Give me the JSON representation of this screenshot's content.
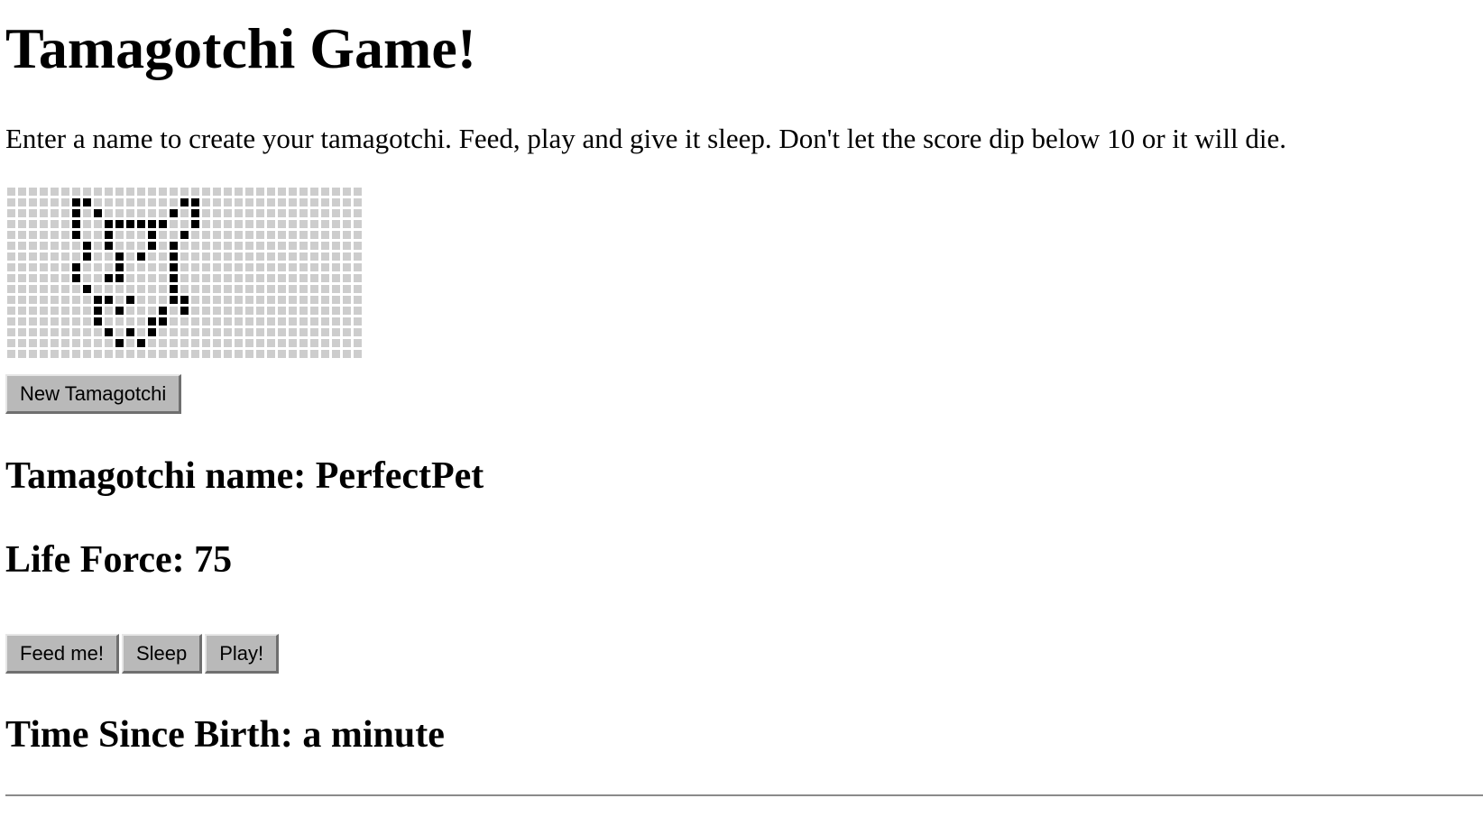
{
  "title": "Tamagotchi Game!",
  "intro": "Enter a name to create your tamagotchi. Feed, play and give it sleep. Don't let the score dip below 10 or it will die.",
  "canvas": {
    "cols": 33,
    "rows": 16,
    "on_pixels": [
      [
        1,
        6
      ],
      [
        1,
        7
      ],
      [
        1,
        16
      ],
      [
        1,
        17
      ],
      [
        2,
        6
      ],
      [
        2,
        8
      ],
      [
        2,
        15
      ],
      [
        2,
        17
      ],
      [
        3,
        6
      ],
      [
        3,
        9
      ],
      [
        3,
        10
      ],
      [
        3,
        11
      ],
      [
        3,
        12
      ],
      [
        3,
        13
      ],
      [
        3,
        14
      ],
      [
        3,
        17
      ],
      [
        4,
        6
      ],
      [
        4,
        9
      ],
      [
        4,
        13
      ],
      [
        4,
        16
      ],
      [
        5,
        7
      ],
      [
        5,
        9
      ],
      [
        5,
        13
      ],
      [
        5,
        15
      ],
      [
        6,
        7
      ],
      [
        6,
        10
      ],
      [
        6,
        12
      ],
      [
        6,
        15
      ],
      [
        7,
        6
      ],
      [
        7,
        10
      ],
      [
        7,
        15
      ],
      [
        8,
        6
      ],
      [
        8,
        9
      ],
      [
        8,
        10
      ],
      [
        8,
        15
      ],
      [
        9,
        7
      ],
      [
        9,
        15
      ],
      [
        10,
        8
      ],
      [
        10,
        9
      ],
      [
        10,
        11
      ],
      [
        10,
        15
      ],
      [
        10,
        16
      ],
      [
        11,
        8
      ],
      [
        11,
        10
      ],
      [
        11,
        14
      ],
      [
        11,
        16
      ],
      [
        12,
        8
      ],
      [
        12,
        13
      ],
      [
        12,
        14
      ],
      [
        13,
        9
      ],
      [
        13,
        11
      ],
      [
        13,
        13
      ],
      [
        14,
        10
      ],
      [
        14,
        12
      ]
    ]
  },
  "buttons": {
    "new": "New Tamagotchi",
    "feed": "Feed me!",
    "sleep": "Sleep",
    "play": "Play!"
  },
  "status": {
    "name_label": "Tamagotchi name: PerfectPet",
    "life_label": "Life Force: 75",
    "time_label": "Time Since Birth: a minute"
  }
}
